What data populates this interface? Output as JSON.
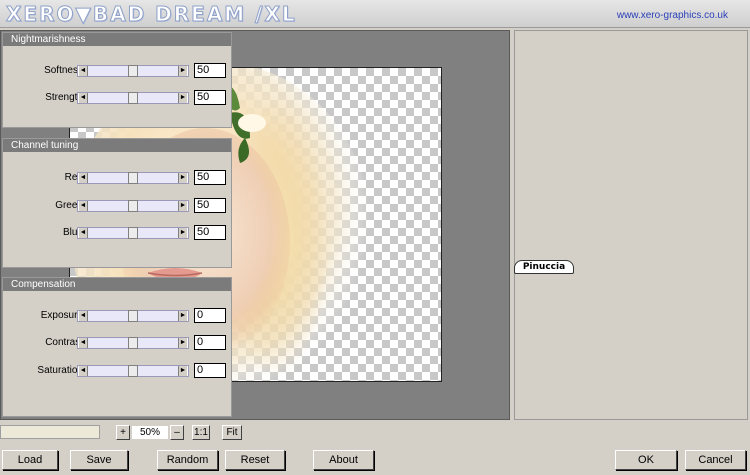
{
  "app": {
    "logo_text": "XERO▼BAD DREAM /XL",
    "url": "www.xero-graphics.co.uk"
  },
  "preview": {
    "badge": "Pinuccia"
  },
  "groups": {
    "nightmarishness": {
      "title": "Nightmarishness",
      "rows": [
        {
          "label": "Softness",
          "value": "50",
          "level": 0.5
        },
        {
          "label": "Strength",
          "value": "50",
          "level": 0.5
        }
      ]
    },
    "channel_tuning": {
      "title": "Channel tuning",
      "rows": [
        {
          "label": "Red",
          "value": "50",
          "level": 0.5
        },
        {
          "label": "Green",
          "value": "50",
          "level": 0.5
        },
        {
          "label": "Blue",
          "value": "50",
          "level": 0.5
        }
      ]
    },
    "compensation": {
      "title": "Compensation",
      "rows": [
        {
          "label": "Exposure",
          "value": "0",
          "level": 0.5
        },
        {
          "label": "Contrast",
          "value": "0",
          "level": 0.5
        },
        {
          "label": "Saturation",
          "value": "0",
          "level": 0.5
        }
      ]
    }
  },
  "zoom": {
    "plus": "+",
    "value": "50%",
    "minus": "–",
    "one_to_one": "1:1",
    "fit": "Fit"
  },
  "buttons": {
    "load": "Load",
    "save": "Save",
    "random": "Random",
    "reset": "Reset",
    "about": "About",
    "ok": "OK",
    "cancel": "Cancel"
  },
  "arrows": {
    "left": "◄",
    "right": "►"
  },
  "colors": {
    "panel_header": "#7b7b7b",
    "slider_track": "#e8e8f8",
    "url": "#2a3fb8"
  }
}
